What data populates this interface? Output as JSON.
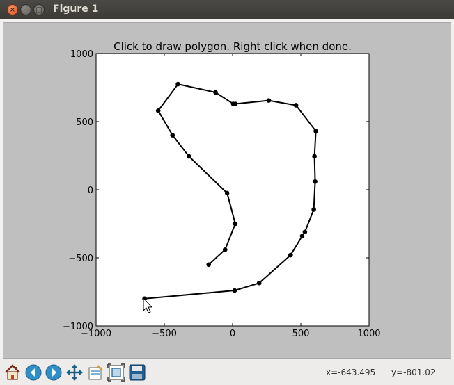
{
  "window": {
    "title": "Figure 1"
  },
  "titlebar_buttons": {
    "close": "×",
    "minimize": "–",
    "maximize": "□"
  },
  "chart_data": {
    "type": "line",
    "title": "Click to draw polygon. Right click when done.",
    "xlim": [
      -1000,
      1000
    ],
    "ylim": [
      -1000,
      1000
    ],
    "x_ticks": [
      -1000,
      -500,
      0,
      500,
      1000
    ],
    "y_ticks": [
      -1000,
      -500,
      0,
      500,
      1000
    ],
    "x_tick_labels": [
      "−1000",
      "−500",
      "0",
      "500",
      "1000"
    ],
    "y_tick_labels": [
      "−1000",
      "−500",
      "0",
      "500",
      "1000"
    ],
    "grid": false,
    "series": [
      {
        "color": "#000000",
        "marker": "circle",
        "x": [
          -175,
          -55,
          20,
          -40,
          -320,
          -440,
          -545,
          -400,
          -125,
          5,
          20,
          265,
          465,
          610,
          600,
          605,
          595,
          530,
          510,
          425,
          195,
          15,
          -645
        ],
        "y": [
          -550,
          -440,
          -250,
          -25,
          245,
          400,
          580,
          775,
          715,
          630,
          630,
          655,
          620,
          430,
          245,
          60,
          -145,
          -310,
          -340,
          -480,
          -685,
          -740,
          -800
        ]
      }
    ]
  },
  "toolbar": {
    "tools": [
      "home-icon",
      "back-icon",
      "forward-icon",
      "pan-icon",
      "subplots-icon",
      "zoom-icon",
      "save-icon"
    ],
    "x_readout": "x=-643.495",
    "y_readout": "y=-801.02"
  }
}
